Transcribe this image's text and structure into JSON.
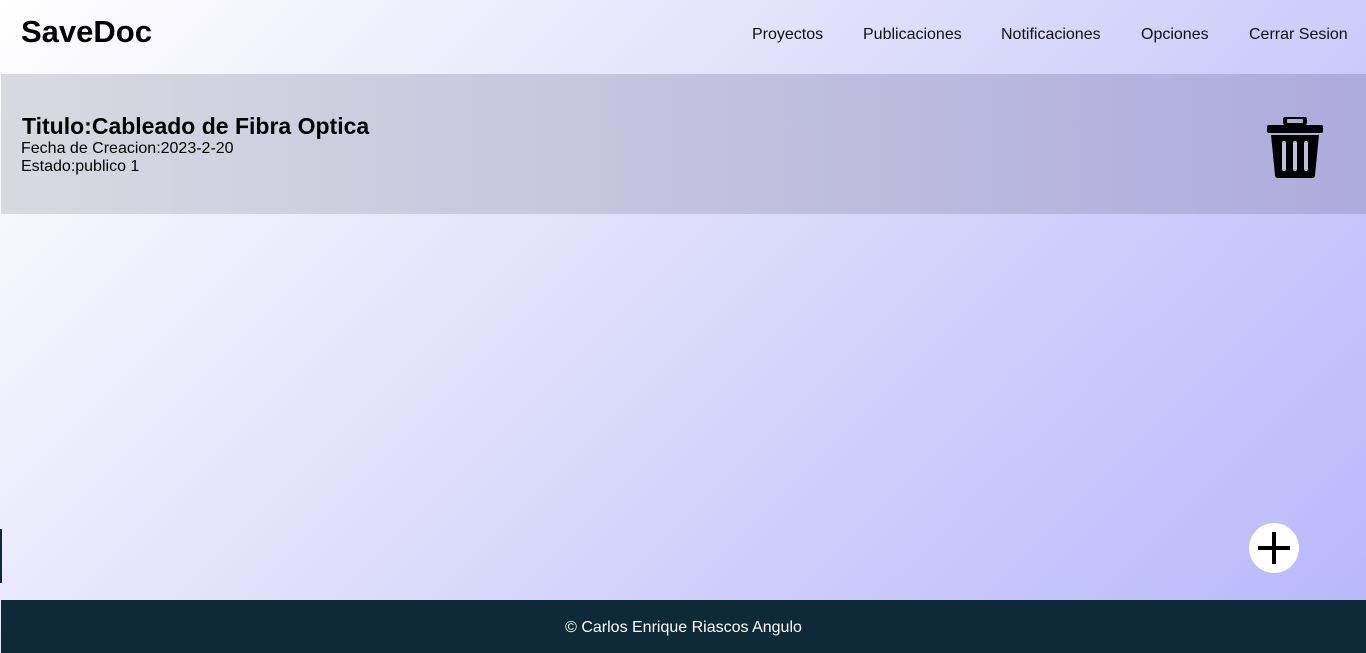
{
  "header": {
    "brand": "SaveDoc",
    "nav": [
      {
        "label": "Proyectos"
      },
      {
        "label": "Publicaciones"
      },
      {
        "label": "Notificaciones"
      },
      {
        "label": "Opciones"
      },
      {
        "label": "Cerrar Sesion"
      }
    ]
  },
  "documents": [
    {
      "title": "Titulo:Cableado de Fibra Optica",
      "created": "Fecha de Creacion:2023-2-20",
      "status": "Estado:publico 1",
      "delete_icon": "trash-icon"
    }
  ],
  "add_button": {
    "icon": "plus-icon"
  },
  "footer": {
    "text": "© Carlos Enrique Riascos Angulo"
  },
  "colors": {
    "footer_bg": "#0e2a38",
    "icon": "#000000"
  }
}
